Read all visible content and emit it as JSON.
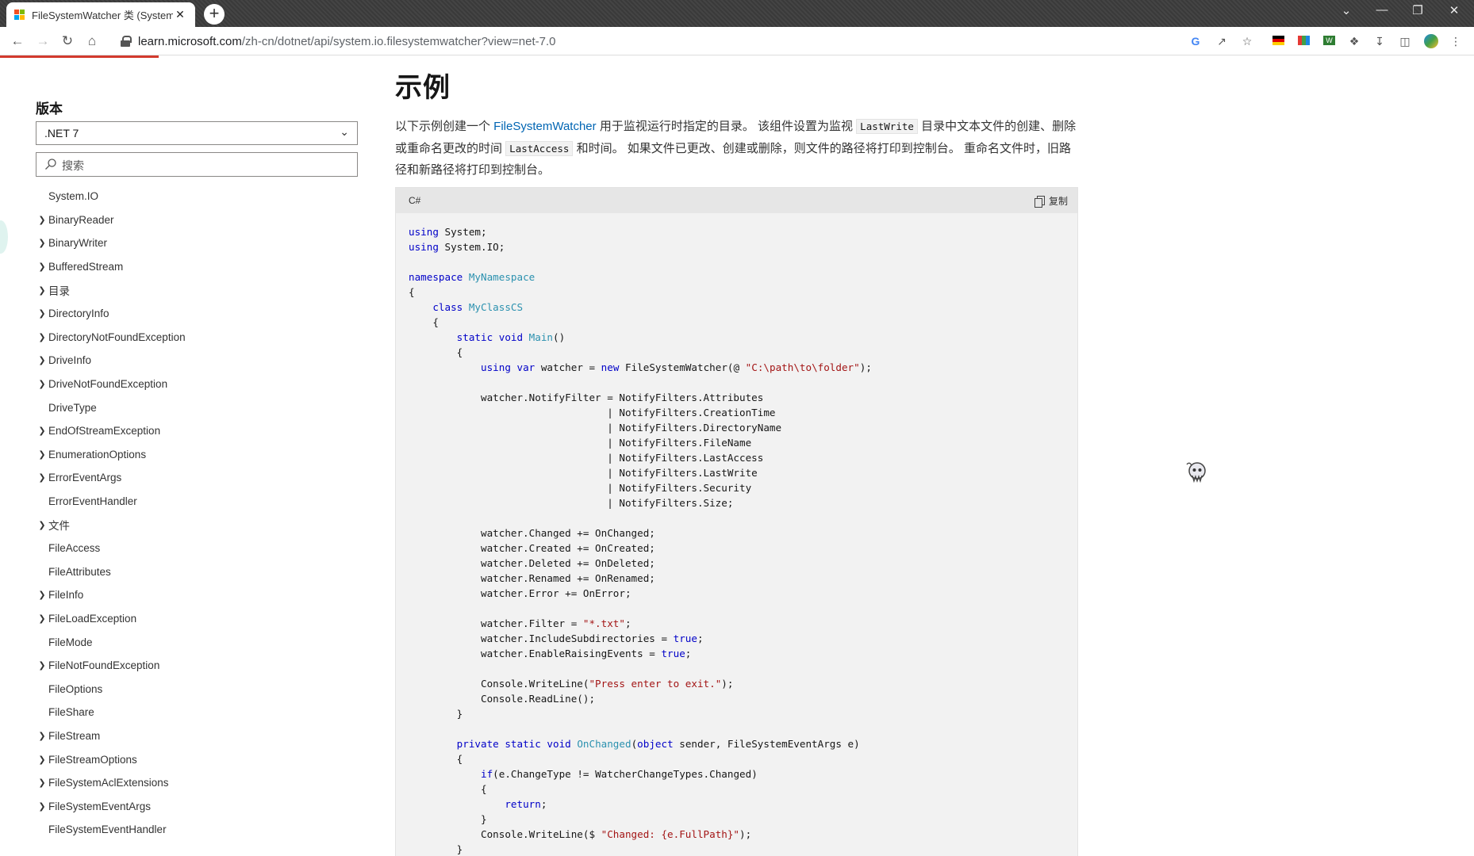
{
  "browser": {
    "tab_title": "FileSystemWatcher 类 (System",
    "tab_close": "✕",
    "new_tab": "+",
    "url_host": "learn.microsoft.com",
    "url_path": "/zh-cn/dotnet/api/system.io.filesystemwatcher?view=net-7.0",
    "window_controls": {
      "dropdown": "⌄",
      "minimize": "—",
      "restore": "❐",
      "close": "✕"
    }
  },
  "sidebar": {
    "version_label": "版本",
    "version_value": ".NET 7",
    "search_placeholder": "搜索",
    "items": [
      {
        "label": "System.IO",
        "expandable": false
      },
      {
        "label": "BinaryReader",
        "expandable": true
      },
      {
        "label": "BinaryWriter",
        "expandable": true
      },
      {
        "label": "BufferedStream",
        "expandable": true
      },
      {
        "label": "目录",
        "expandable": true
      },
      {
        "label": "DirectoryInfo",
        "expandable": true
      },
      {
        "label": "DirectoryNotFoundException",
        "expandable": true
      },
      {
        "label": "DriveInfo",
        "expandable": true
      },
      {
        "label": "DriveNotFoundException",
        "expandable": true
      },
      {
        "label": "DriveType",
        "expandable": false
      },
      {
        "label": "EndOfStreamException",
        "expandable": true
      },
      {
        "label": "EnumerationOptions",
        "expandable": true
      },
      {
        "label": "ErrorEventArgs",
        "expandable": true
      },
      {
        "label": "ErrorEventHandler",
        "expandable": false
      },
      {
        "label": "文件",
        "expandable": true
      },
      {
        "label": "FileAccess",
        "expandable": false
      },
      {
        "label": "FileAttributes",
        "expandable": false
      },
      {
        "label": "FileInfo",
        "expandable": true
      },
      {
        "label": "FileLoadException",
        "expandable": true
      },
      {
        "label": "FileMode",
        "expandable": false
      },
      {
        "label": "FileNotFoundException",
        "expandable": true
      },
      {
        "label": "FileOptions",
        "expandable": false
      },
      {
        "label": "FileShare",
        "expandable": false
      },
      {
        "label": "FileStream",
        "expandable": true
      },
      {
        "label": "FileStreamOptions",
        "expandable": true
      },
      {
        "label": "FileSystemAclExtensions",
        "expandable": true
      },
      {
        "label": "FileSystemEventArgs",
        "expandable": true
      },
      {
        "label": "FileSystemEventHandler",
        "expandable": false
      }
    ]
  },
  "main": {
    "heading": "示例",
    "desc_part1": "以下示例创建一个 ",
    "desc_link": "FileSystemWatcher",
    "desc_part2": " 用于监视运行时指定的目录。 该组件设置为监视 ",
    "desc_code1": "LastWrite",
    "desc_part3": " 目录中文本文件的创建、删除或重命名更改的时间 ",
    "desc_code2": "LastAccess",
    "desc_part4": " 和时间。 如果文件已更改、创建或删除，则文件的路径将打印到控制台。 重命名文件时，旧路径和新路径将打印到控制台。",
    "code_lang": "C#",
    "copy_label": "复制",
    "code_lines": [
      [
        [
          "kw",
          "using"
        ],
        [
          "",
          "System;"
        ]
      ],
      [
        [
          "kw",
          "using"
        ],
        [
          "",
          "System.IO;"
        ]
      ],
      [],
      [
        [
          "kw",
          "namespace"
        ],
        [
          "ty",
          "MyNamespace"
        ]
      ],
      [
        [
          "",
          "{"
        ]
      ],
      [
        [
          "",
          "    "
        ],
        [
          "kw",
          "class"
        ],
        [
          "ty",
          "MyClassCS"
        ]
      ],
      [
        [
          "",
          "    {"
        ]
      ],
      [
        [
          "",
          "        "
        ],
        [
          "kw",
          "static void"
        ],
        [
          "ty",
          "Main"
        ],
        [
          "",
          "()"
        ]
      ],
      [
        [
          "",
          "        {"
        ]
      ],
      [
        [
          "",
          "            "
        ],
        [
          "kw",
          "using var"
        ],
        [
          "",
          "watcher ="
        ],
        [
          "kw",
          "new"
        ],
        [
          "",
          "FileSystemWatcher(@"
        ],
        [
          "st",
          "\"C:\\path\\to\\folder\""
        ],
        [
          "",
          ");"
        ]
      ],
      [],
      [
        [
          "",
          "            watcher.NotifyFilter = NotifyFilters.Attributes"
        ]
      ],
      [
        [
          "",
          "                                 | NotifyFilters.CreationTime"
        ]
      ],
      [
        [
          "",
          "                                 | NotifyFilters.DirectoryName"
        ]
      ],
      [
        [
          "",
          "                                 | NotifyFilters.FileName"
        ]
      ],
      [
        [
          "",
          "                                 | NotifyFilters.LastAccess"
        ]
      ],
      [
        [
          "",
          "                                 | NotifyFilters.LastWrite"
        ]
      ],
      [
        [
          "",
          "                                 | NotifyFilters.Security"
        ]
      ],
      [
        [
          "",
          "                                 | NotifyFilters.Size;"
        ]
      ],
      [],
      [
        [
          "",
          "            watcher.Changed += OnChanged;"
        ]
      ],
      [
        [
          "",
          "            watcher.Created += OnCreated;"
        ]
      ],
      [
        [
          "",
          "            watcher.Deleted += OnDeleted;"
        ]
      ],
      [
        [
          "",
          "            watcher.Renamed += OnRenamed;"
        ]
      ],
      [
        [
          "",
          "            watcher.Error += OnError;"
        ]
      ],
      [],
      [
        [
          "",
          "            watcher.Filter = "
        ],
        [
          "st",
          "\"*.txt\""
        ],
        [
          "",
          ";"
        ]
      ],
      [
        [
          "",
          "            watcher.IncludeSubdirectories = "
        ],
        [
          "kw",
          "true"
        ],
        [
          "",
          ";"
        ]
      ],
      [
        [
          "",
          "            watcher.EnableRaisingEvents = "
        ],
        [
          "kw",
          "true"
        ],
        [
          "",
          ";"
        ]
      ],
      [],
      [
        [
          "",
          "            Console.WriteLine("
        ],
        [
          "st",
          "\"Press enter to exit.\""
        ],
        [
          "",
          ");"
        ]
      ],
      [
        [
          "",
          "            Console.ReadLine();"
        ]
      ],
      [
        [
          "",
          "        }"
        ]
      ],
      [],
      [
        [
          "",
          "        "
        ],
        [
          "kw",
          "private static void"
        ],
        [
          "ty",
          "OnChanged"
        ],
        [
          "",
          "("
        ],
        [
          "kw",
          "object"
        ],
        [
          "",
          "sender, FileSystemEventArgs e)"
        ]
      ],
      [
        [
          "",
          "        {"
        ]
      ],
      [
        [
          "",
          "            "
        ],
        [
          "kw",
          "if"
        ],
        [
          "",
          "(e.ChangeType != WatcherChangeTypes.Changed)"
        ]
      ],
      [
        [
          "",
          "            {"
        ]
      ],
      [
        [
          "",
          "                "
        ],
        [
          "kw",
          "return"
        ],
        [
          "",
          ";"
        ]
      ],
      [
        [
          "",
          "            }"
        ]
      ],
      [
        [
          "",
          "            Console.WriteLine($"
        ],
        [
          "st",
          "\"Changed: {e.FullPath}\""
        ],
        [
          "",
          ");"
        ]
      ],
      [
        [
          "",
          "        }"
        ]
      ]
    ]
  },
  "colors": {
    "link": "#0065b3",
    "keyword": "#0000c8",
    "type": "#2b91af",
    "string": "#a31515",
    "progress": "#d23a2e"
  }
}
